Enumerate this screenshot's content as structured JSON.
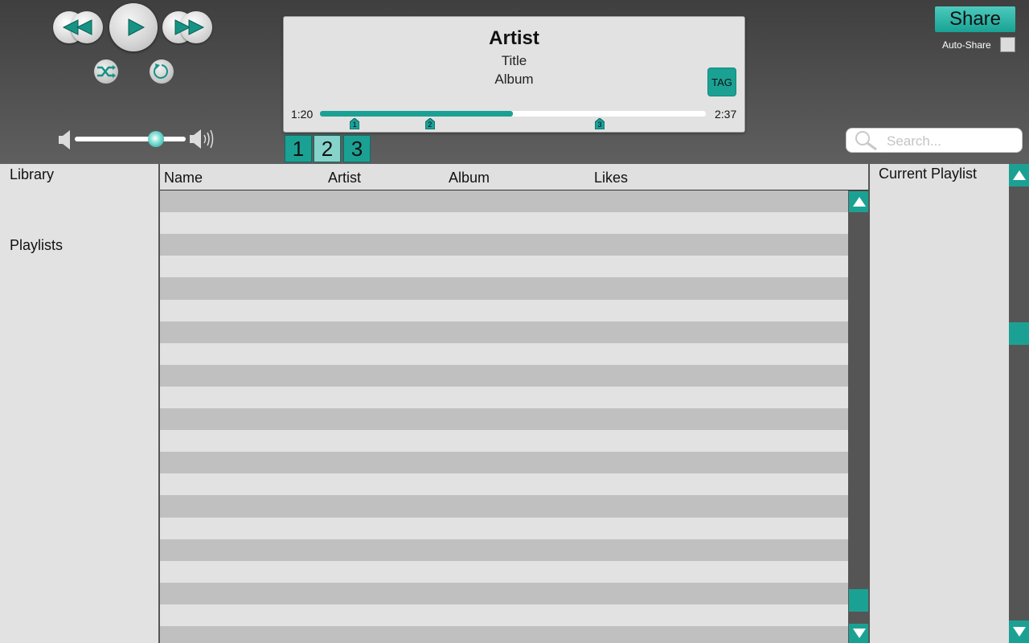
{
  "transport": {
    "rewind_icon": "rewind-icon",
    "play_icon": "play-icon",
    "fast_forward_icon": "fast-forward-icon",
    "shuffle_icon": "shuffle-icon",
    "repeat_icon": "repeat-icon"
  },
  "volume": {
    "level": 0.73,
    "mute_icon": "speaker-mute-icon",
    "loud_icon": "speaker-loud-icon"
  },
  "now_playing": {
    "artist": "Artist",
    "title": "Title",
    "album": "Album",
    "tag_label": "TAG",
    "elapsed": "1:20",
    "total": "2:37",
    "progress": 0.5,
    "markers": [
      {
        "label": "1",
        "position": 0.09
      },
      {
        "label": "2",
        "position": 0.285
      },
      {
        "label": "3",
        "position": 0.725
      }
    ]
  },
  "tabs": [
    {
      "label": "1",
      "state": "active"
    },
    {
      "label": "2",
      "state": "light"
    },
    {
      "label": "3",
      "state": "active"
    }
  ],
  "share": {
    "button_label": "Share",
    "auto_share_label": "Auto-Share",
    "auto_share_checked": false
  },
  "search": {
    "placeholder": "Search...",
    "icon": "search-icon"
  },
  "sidebar": {
    "library_label": "Library",
    "playlists_label": "Playlists"
  },
  "table": {
    "columns": [
      "Name",
      "Artist",
      "Album",
      "Likes"
    ],
    "row_count": 21,
    "scroll_position": 0.97
  },
  "current_playlist": {
    "label": "Current Playlist",
    "scroll_position": 0.33
  },
  "colors": {
    "accent": "#1ba194",
    "row_dark": "#c0c0c0",
    "row_light": "#e2e2e2",
    "panel_bg": "#e2e2e2",
    "header_bg": "#4a4a4a"
  }
}
